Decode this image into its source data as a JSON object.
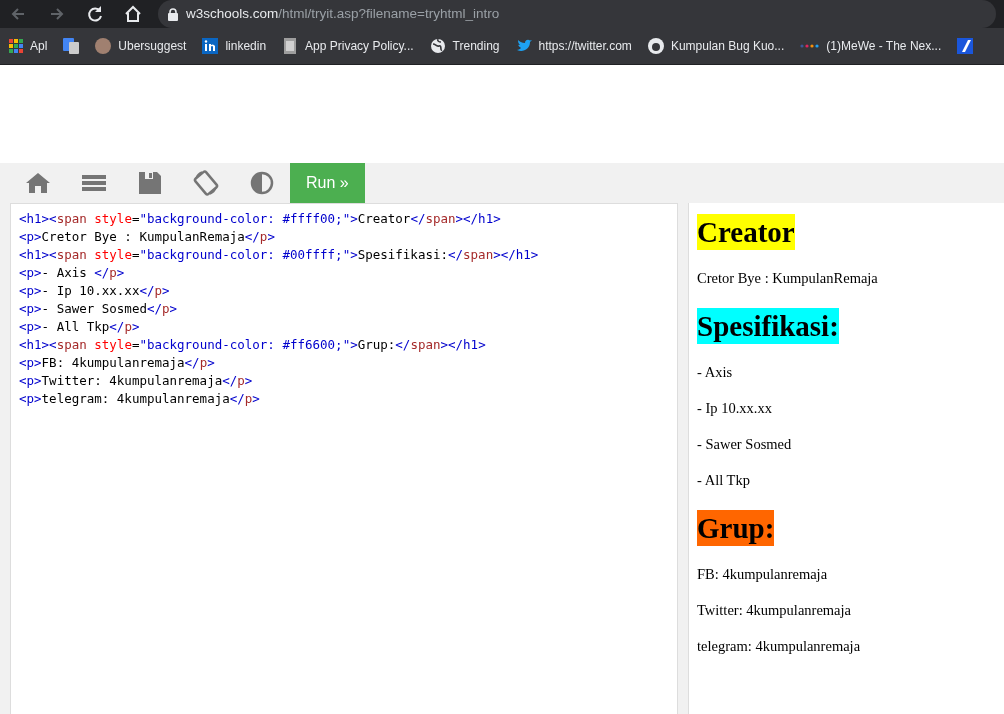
{
  "browser": {
    "url_host": "w3schools.com",
    "url_path": "/html/tryit.asp?filename=tryhtml_intro",
    "bookmarks": [
      {
        "kind": "labeled",
        "label": "Apl"
      },
      {
        "kind": "icon"
      },
      {
        "kind": "labeled",
        "label": "Ubersuggest"
      },
      {
        "kind": "labeled",
        "label": "linkedin"
      },
      {
        "kind": "labeled",
        "label": "App Privacy Policy..."
      },
      {
        "kind": "labeled",
        "label": "Trending"
      },
      {
        "kind": "labeled",
        "label": "https://twitter.com"
      },
      {
        "kind": "labeled",
        "label": "Kumpulan Bug Kuo..."
      },
      {
        "kind": "labeled",
        "label": "(1)MeWe - The Nex..."
      },
      {
        "kind": "icon"
      }
    ]
  },
  "toolbar": {
    "run_label": "Run »"
  },
  "code_lines": [
    [
      {
        "kind": "b",
        "text": "<h1><"
      },
      {
        "kind": "n",
        "text": "span"
      },
      {
        "kind": "a",
        "text": " style"
      },
      {
        "kind": "t",
        "text": "="
      },
      {
        "kind": "v",
        "text": "\"background-color: #ffff00;\""
      },
      {
        "kind": "b",
        "text": ">"
      },
      {
        "kind": "t",
        "text": "Creator"
      },
      {
        "kind": "b",
        "text": "</"
      },
      {
        "kind": "n",
        "text": "span"
      },
      {
        "kind": "b",
        "text": "></h1>"
      }
    ],
    [
      {
        "kind": "b",
        "text": "<p>"
      },
      {
        "kind": "t",
        "text": "Cretor Bye : KumpulanRemaja"
      },
      {
        "kind": "b",
        "text": "</"
      },
      {
        "kind": "n",
        "text": "p"
      },
      {
        "kind": "b",
        "text": ">"
      }
    ],
    [
      {
        "kind": "b",
        "text": "<h1><"
      },
      {
        "kind": "n",
        "text": "span"
      },
      {
        "kind": "a",
        "text": " style"
      },
      {
        "kind": "t",
        "text": "="
      },
      {
        "kind": "v",
        "text": "\"background-color: #00ffff;\""
      },
      {
        "kind": "b",
        "text": ">"
      },
      {
        "kind": "t",
        "text": "Spesifikasi:"
      },
      {
        "kind": "b",
        "text": "</"
      },
      {
        "kind": "n",
        "text": "span"
      },
      {
        "kind": "b",
        "text": "></h1>"
      }
    ],
    [
      {
        "kind": "b",
        "text": "<p>"
      },
      {
        "kind": "t",
        "text": "- Axis "
      },
      {
        "kind": "b",
        "text": "</"
      },
      {
        "kind": "n",
        "text": "p"
      },
      {
        "kind": "b",
        "text": ">"
      }
    ],
    [
      {
        "kind": "b",
        "text": "<p>"
      },
      {
        "kind": "t",
        "text": "- Ip 10.xx.xx"
      },
      {
        "kind": "b",
        "text": "</"
      },
      {
        "kind": "n",
        "text": "p"
      },
      {
        "kind": "b",
        "text": ">"
      }
    ],
    [
      {
        "kind": "b",
        "text": "<p>"
      },
      {
        "kind": "t",
        "text": "- Sawer Sosmed"
      },
      {
        "kind": "b",
        "text": "</"
      },
      {
        "kind": "n",
        "text": "p"
      },
      {
        "kind": "b",
        "text": ">"
      }
    ],
    [
      {
        "kind": "b",
        "text": "<p>"
      },
      {
        "kind": "t",
        "text": "- All Tkp"
      },
      {
        "kind": "b",
        "text": "</"
      },
      {
        "kind": "n",
        "text": "p"
      },
      {
        "kind": "b",
        "text": ">"
      }
    ],
    [
      {
        "kind": "b",
        "text": "<h1><"
      },
      {
        "kind": "n",
        "text": "span"
      },
      {
        "kind": "a",
        "text": " style"
      },
      {
        "kind": "t",
        "text": "="
      },
      {
        "kind": "v",
        "text": "\"background-color: #ff6600;\""
      },
      {
        "kind": "b",
        "text": ">"
      },
      {
        "kind": "t",
        "text": "Grup:"
      },
      {
        "kind": "b",
        "text": "</"
      },
      {
        "kind": "n",
        "text": "span"
      },
      {
        "kind": "b",
        "text": "></h1>"
      }
    ],
    [
      {
        "kind": "b",
        "text": "<p>"
      },
      {
        "kind": "t",
        "text": "FB: 4kumpulanremaja"
      },
      {
        "kind": "b",
        "text": "</"
      },
      {
        "kind": "n",
        "text": "p"
      },
      {
        "kind": "b",
        "text": ">"
      }
    ],
    [
      {
        "kind": "b",
        "text": "<p>"
      },
      {
        "kind": "t",
        "text": "Twitter: 4kumpulanremaja"
      },
      {
        "kind": "b",
        "text": "</"
      },
      {
        "kind": "n",
        "text": "p"
      },
      {
        "kind": "b",
        "text": ">"
      }
    ],
    [
      {
        "kind": "b",
        "text": "<p>"
      },
      {
        "kind": "t",
        "text": "telegram: 4kumpulanremaja"
      },
      {
        "kind": "b",
        "text": "</"
      },
      {
        "kind": "n",
        "text": "p"
      },
      {
        "kind": "b",
        "text": ">"
      }
    ]
  ],
  "output": [
    {
      "kind": "h1",
      "text": "Creator",
      "color": "#ffff00"
    },
    {
      "kind": "p",
      "text": "Cretor Bye : KumpulanRemaja"
    },
    {
      "kind": "h1",
      "text": "Spesifikasi:",
      "color": "#00ffff"
    },
    {
      "kind": "p",
      "text": "- Axis"
    },
    {
      "kind": "p",
      "text": "- Ip 10.xx.xx"
    },
    {
      "kind": "p",
      "text": "- Sawer Sosmed"
    },
    {
      "kind": "p",
      "text": "- All Tkp"
    },
    {
      "kind": "h1",
      "text": "Grup:",
      "color": "#ff6600"
    },
    {
      "kind": "p",
      "text": "FB: 4kumpulanremaja"
    },
    {
      "kind": "p",
      "text": "Twitter: 4kumpulanremaja"
    },
    {
      "kind": "p",
      "text": "telegram: 4kumpulanremaja"
    }
  ]
}
